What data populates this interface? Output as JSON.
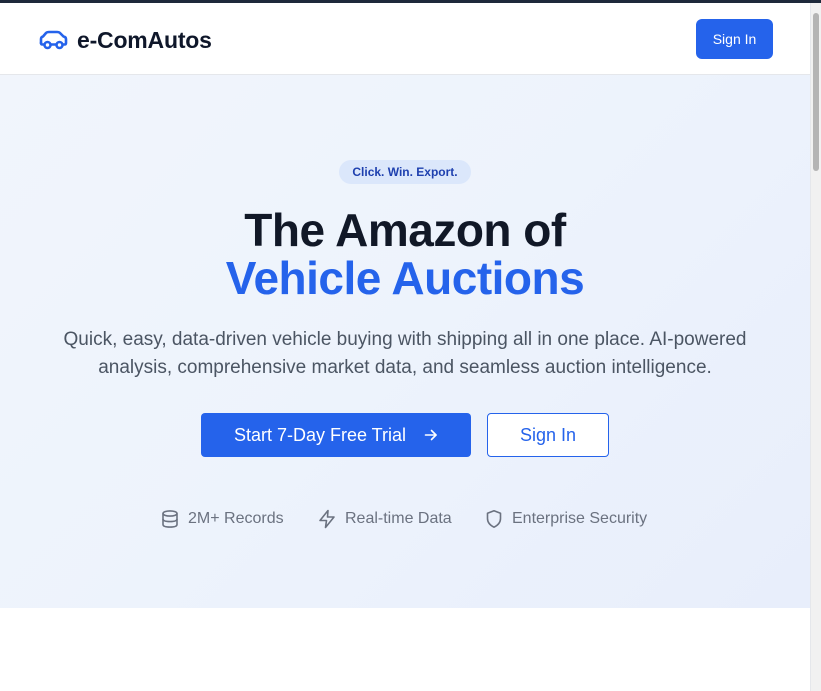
{
  "app": {
    "brand_name": "e-ComAutos",
    "brand_icon": "car-icon"
  },
  "navbar": {
    "signin_label": "Sign In"
  },
  "hero": {
    "tagline": "Click. Win. Export.",
    "headline_line1": "The Amazon of",
    "headline_line2": "Vehicle Auctions",
    "subtitle_line1": "Quick, easy, data-driven vehicle buying with shipping all in one place. AI-powered",
    "subtitle_line2": "analysis, comprehensive market data, and seamless auction intelligence.",
    "primary_cta": "Start 7-Day Free Trial",
    "primary_cta_icon": "arrow-right-icon",
    "secondary_cta": "Sign In"
  },
  "features": [
    {
      "label": "2M+ Records",
      "icon": "database-icon"
    },
    {
      "label": "Real-time Data",
      "icon": "lightning-icon"
    },
    {
      "label": "Enterprise Security",
      "icon": "shield-icon"
    }
  ],
  "colors": {
    "accent": "#2563eb",
    "hero_background": "#edf3fc",
    "tagline_background": "#dbe7fb",
    "headline_dark": "#111827",
    "muted_text": "#6b7280"
  }
}
